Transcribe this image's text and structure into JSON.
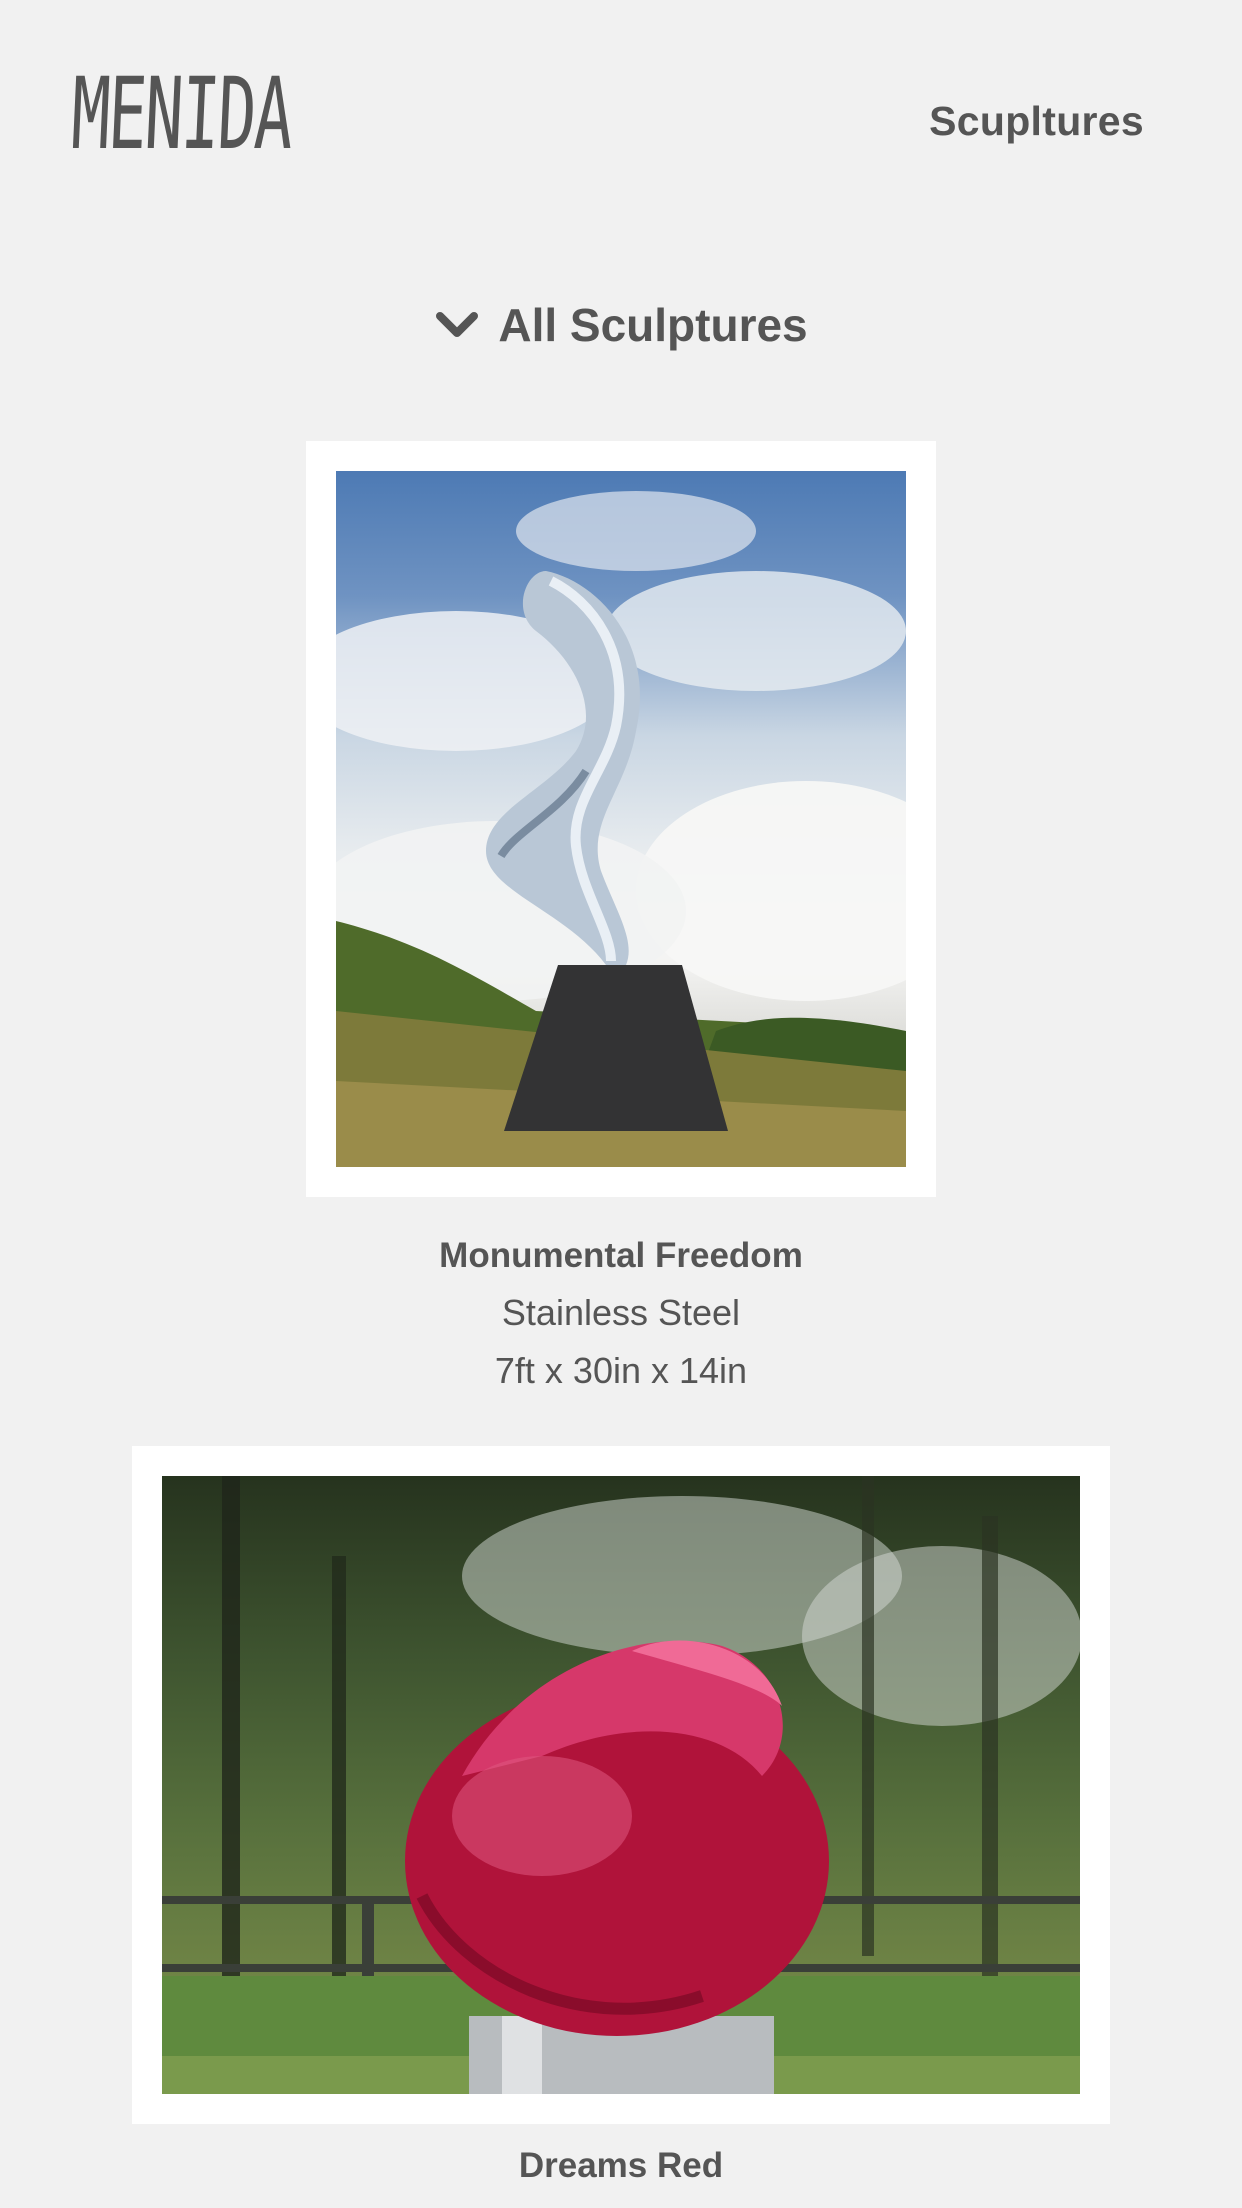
{
  "header": {
    "logo_text": "MENIDA",
    "nav_link": "Scupltures"
  },
  "filter": {
    "label": "All Sculptures",
    "icon": "chevron-down-icon"
  },
  "sculptures": [
    {
      "title": "Monumental Freedom",
      "material": "Stainless Steel",
      "dimensions": "7ft x 30in x 14in"
    },
    {
      "title": "Dreams Red"
    }
  ]
}
